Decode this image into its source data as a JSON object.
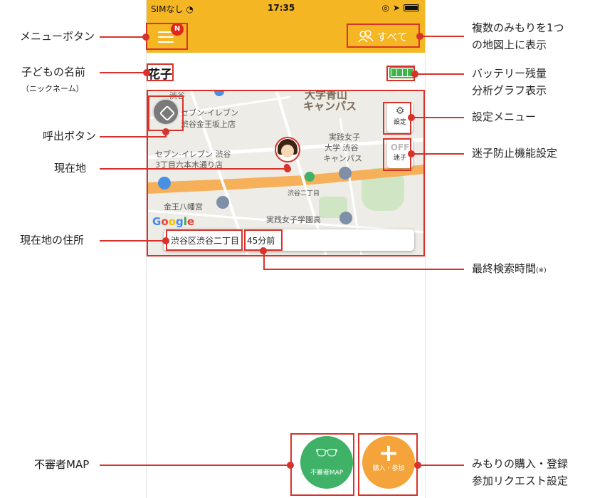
{
  "status_bar": {
    "carrier": "SIMなし",
    "time": "17:35"
  },
  "header": {
    "notification_badge": "N",
    "all_button_label": "すべて"
  },
  "child": {
    "name": "花子",
    "battery_level": 1.0
  },
  "map": {
    "labels": [
      "大学青山",
      "キャンパス",
      "セブン-イレブン",
      "渋谷金王坂上店",
      "セブン-イレブン 渋谷",
      "3丁目六本木通り店",
      "実践女子",
      "大学 渋谷",
      "キャンパス",
      "渋谷二丁目",
      "金王八幡宮",
      "実践女子学園高",
      "渋谷"
    ],
    "google_logo": "Google",
    "settings_label": "設定",
    "lost_child_state": "OFF",
    "lost_child_label": "迷子",
    "address": "渋谷区渋谷二丁目",
    "last_search_time": "45分前"
  },
  "bottom_buttons": {
    "suspicious_map_label": "不審者MAP",
    "purchase_label": "購入・参加"
  },
  "annotations": {
    "menu_button": "メニューボタン",
    "multi_map_line1": "複数のみもりを1つ",
    "multi_map_line2": "の地図上に表示",
    "child_name": "子どもの名前",
    "child_name_sub": "（ニックネーム）",
    "battery_line1": "バッテリー残量",
    "battery_line2": "分析グラフ表示",
    "settings_menu": "設定メニュー",
    "call_button": "呼出ボタン",
    "lost_child_setting": "迷子防止機能設定",
    "current_location": "現在地",
    "current_address": "現在地の住所",
    "last_search_time": "最終検索時間",
    "last_search_note": "(※)",
    "suspicious_map": "不審者MAP",
    "purchase_line1": "みもりの購入・登録",
    "purchase_line2": "参加リクエスト設定"
  },
  "colors": {
    "brand": "#f5b623",
    "annotation": "#d9322a",
    "green": "#3fb268",
    "orange": "#f4a43b"
  }
}
